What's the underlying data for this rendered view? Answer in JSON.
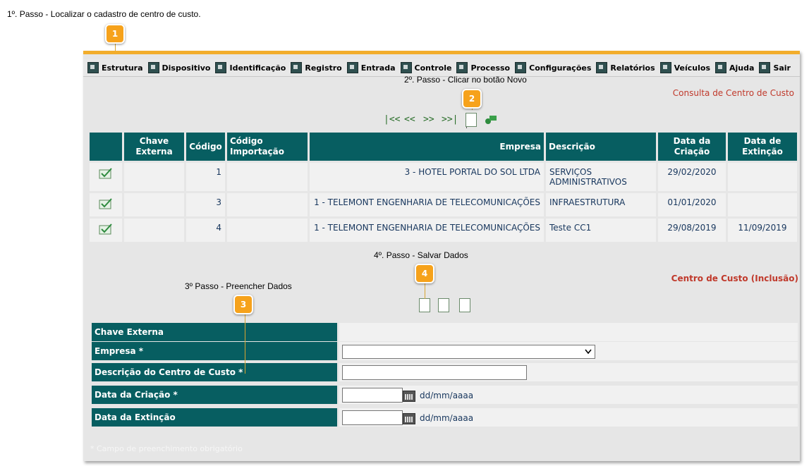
{
  "steps": {
    "step1": "1º. Passo - Localizar o cadastro de centro de custo.",
    "step2": "2º. Passo - Clicar no botão Novo",
    "step3": "3º Passo - Preencher Dados",
    "step4": "4º. Passo - Salvar Dados"
  },
  "badges": [
    "1",
    "2",
    "3",
    "4"
  ],
  "menu": [
    {
      "label": "Estrutura",
      "icon": "structure-icon"
    },
    {
      "label": "Dispositivo",
      "icon": "device-icon"
    },
    {
      "label": "Identificação",
      "icon": "identification-icon"
    },
    {
      "label": "Registro",
      "icon": "register-icon"
    },
    {
      "label": "Entrada",
      "icon": "entry-icon"
    },
    {
      "label": "Controle",
      "icon": "control-icon"
    },
    {
      "label": "Processo",
      "icon": "process-icon"
    },
    {
      "label": "Configurações",
      "icon": "settings-icon"
    },
    {
      "label": "Relatórios",
      "icon": "reports-icon"
    },
    {
      "label": "Veículos",
      "icon": "vehicles-icon"
    },
    {
      "label": "Ajuda",
      "icon": "help-icon"
    },
    {
      "label": "Sair",
      "icon": "exit-icon"
    }
  ],
  "consulta_title": "Consulta de Centro de Custo",
  "navigation": {
    "first": "|<<",
    "prev": "<<",
    "next": ">>",
    "last": ">>|"
  },
  "table": {
    "headers": [
      "",
      "Chave Externa",
      "Código",
      "Código Importação",
      "Empresa",
      "Descrição",
      "Data da Criação",
      "Data de Extinção"
    ],
    "rows": [
      {
        "chave": "",
        "codigo": "1",
        "codigo_importacao": "",
        "empresa": "3 - HOTEL PORTAL DO SOL LTDA",
        "descricao": "SERVIÇOS ADMINISTRATIVOS",
        "data_criacao": "29/02/2020",
        "data_extincao": ""
      },
      {
        "chave": "",
        "codigo": "3",
        "codigo_importacao": "",
        "empresa": "1 - TELEMONT ENGENHARIA DE TELECOMUNICAÇÕES",
        "descricao": "INFRAESTRUTURA",
        "data_criacao": "01/01/2020",
        "data_extincao": ""
      },
      {
        "chave": "",
        "codigo": "4",
        "codigo_importacao": "",
        "empresa": "1 - TELEMONT ENGENHARIA DE TELECOMUNICAÇÕES",
        "descricao": "Teste CC1",
        "data_criacao": "29/08/2019",
        "data_extincao": "11/09/2019"
      }
    ]
  },
  "form": {
    "title": "Centro de Custo (Inclusão)",
    "labels": {
      "chave": "Chave Externa",
      "empresa": "Empresa *",
      "descricao": "Descrição do Centro de Custo *",
      "criacao": "Data da Criação *",
      "extincao": "Data da Extinção"
    },
    "values": {
      "empresa": "",
      "descricao": "",
      "criacao": "",
      "extincao": ""
    },
    "date_hint": "dd/mm/aaaa",
    "footnote": "* Campo de preenchimento obrigatório"
  },
  "colors": {
    "header_teal": "#075e61",
    "accent_orange": "#f2ad2c",
    "badge_orange": "#f6a21b",
    "title_red": "#c0392b",
    "link_blue": "#17365d"
  }
}
